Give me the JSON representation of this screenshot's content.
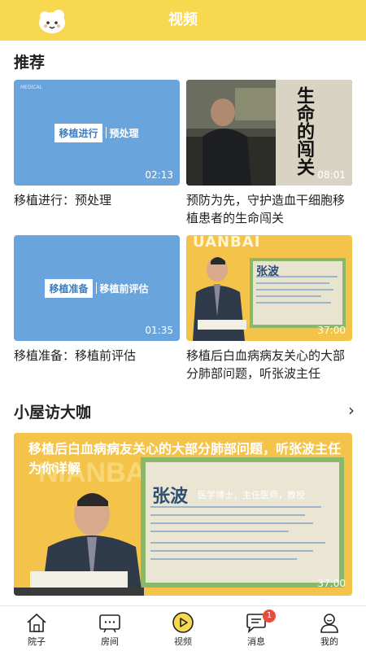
{
  "header": {
    "title": "视频",
    "mascot_icon": "cloud-mascot-icon",
    "bar_color": "#f8d84e"
  },
  "recommend": {
    "title": "推荐",
    "cards": [
      {
        "caption": "移植进行：预处理",
        "duration": "02:13",
        "thumb_tag": "移植进行",
        "thumb_text": "预处理",
        "thumb_logo": "MEDICAL"
      },
      {
        "caption": "预防为先，守护造血干细胞移植患者的生命闯关",
        "duration": "08:01",
        "thumb_title": "生命的闯关"
      },
      {
        "caption": "移植准备：移植前评估",
        "duration": "01:35",
        "thumb_tag": "移植准备",
        "thumb_text": "移植前评估"
      },
      {
        "caption": "移植后白血病病友关心的大部分肺部问题，听张波主任",
        "duration": "37:00",
        "thumb_top_text": "UANBAI",
        "thumb_name": "张波"
      }
    ]
  },
  "interview": {
    "title": "小屋访大咖",
    "more_icon": "chevron-right-icon",
    "banner": {
      "headline": "移植后白血病病友关心的大部分肺部问题，听张波主任为你详解",
      "duration": "37:00",
      "name": "张波",
      "subtitle": "医学博士，主任医师，教授",
      "watermark": "NIANBAI"
    }
  },
  "tabbar": {
    "tabs": [
      {
        "label": "院子",
        "icon": "house-icon"
      },
      {
        "label": "房间",
        "icon": "tv-icon"
      },
      {
        "label": "视频",
        "icon": "play-circle-icon",
        "active": true
      },
      {
        "label": "消息",
        "icon": "chat-bubble-icon",
        "badge": "1"
      },
      {
        "label": "我的",
        "icon": "user-icon"
      }
    ]
  },
  "colors": {
    "accent": "#f8d84e",
    "badge": "#e84a3b",
    "thumb_blue": "#6aa4dc"
  }
}
